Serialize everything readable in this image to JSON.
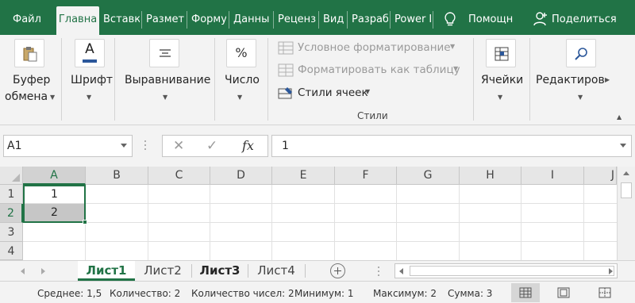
{
  "tabs": [
    {
      "label": "Файл"
    },
    {
      "label": "Главна"
    },
    {
      "label": "Вставк"
    },
    {
      "label": "Размет"
    },
    {
      "label": "Форму"
    },
    {
      "label": "Данны"
    },
    {
      "label": "Реценз"
    },
    {
      "label": "Вид"
    },
    {
      "label": "Разраб"
    },
    {
      "label": "Power I"
    }
  ],
  "help_label": "Помощн",
  "share_label": "Поделиться",
  "ribbon": {
    "clipboard": {
      "line1": "Буфер",
      "line2": "обмена"
    },
    "font": "Шрифт",
    "alignment": "Выравнивание",
    "number": "Число",
    "number_icon": "%",
    "font_icon": "A",
    "styles": {
      "conditional": "Условное форматирование",
      "as_table": "Форматировать как таблицу",
      "cell_styles": "Стили ячеек",
      "group_caption": "Стили"
    },
    "cells": "Ячейки",
    "editing": "Редактиров"
  },
  "formula_bar": {
    "name_box": "A1",
    "cancel_glyph": "✕",
    "enter_glyph": "✓",
    "fx_glyph": "fx",
    "value": "1"
  },
  "grid": {
    "columns": [
      "A",
      "B",
      "C",
      "D",
      "E",
      "F",
      "G",
      "H",
      "I",
      "J"
    ],
    "rows": [
      "1",
      "2",
      "3",
      "4"
    ],
    "cells": {
      "A1": "1",
      "A2": "2"
    }
  },
  "sheets": [
    {
      "name": "Лист1"
    },
    {
      "name": "Лист2"
    },
    {
      "name": "Лист3"
    },
    {
      "name": "Лист4"
    }
  ],
  "status": {
    "average": "Среднее: 1,5",
    "count": "Количество: 2",
    "numeric_count": "Количество чисел: 2",
    "min": "Минимум: 1",
    "max": "Максимум: 2",
    "sum": "Сумма: 3"
  },
  "colors": {
    "accent": "#217346"
  }
}
